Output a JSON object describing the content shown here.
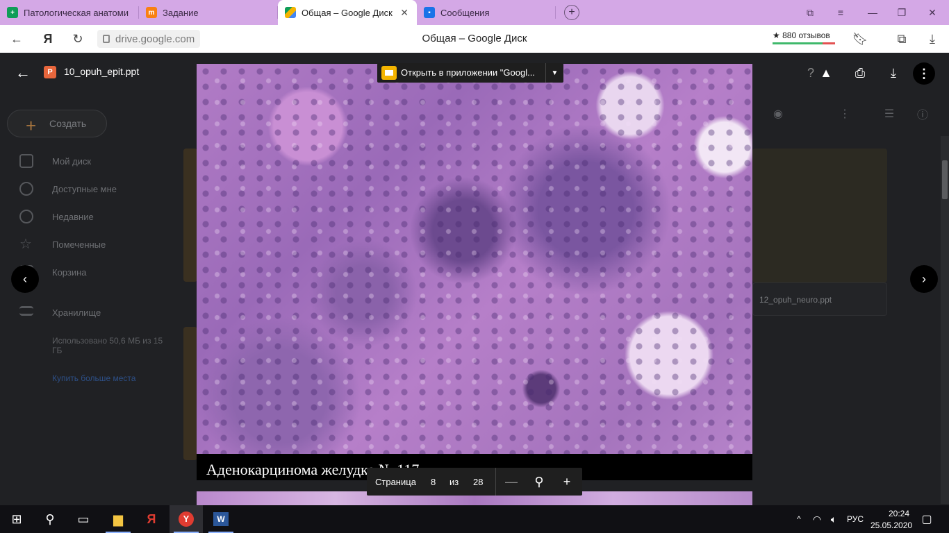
{
  "browser": {
    "tabs": [
      {
        "label": "Патологическая анатоми",
        "icon": "sheets-icon",
        "color": "#0f9d58"
      },
      {
        "label": "Задание",
        "icon": "moodle-icon",
        "color": "#f98012"
      },
      {
        "label": "Общая – Google Диск",
        "icon": "drive-icon",
        "color": "#4285f4",
        "active": true
      },
      {
        "label": "Сообщения",
        "icon": "chat-icon",
        "color": "#1a73e8"
      }
    ],
    "url": "drive.google.com",
    "page_title": "Общая – Google Диск",
    "reviews": "★ 880 отзывов"
  },
  "drive": {
    "create_label": "Создать",
    "sidebar": [
      {
        "label": "Мой диск",
        "icon": "my-drive-icon"
      },
      {
        "label": "Доступные мне",
        "icon": "shared-icon"
      },
      {
        "label": "Недавние",
        "icon": "clock-icon"
      },
      {
        "label": "Помеченные",
        "icon": "star-icon"
      },
      {
        "label": "Корзина",
        "icon": "trash-icon"
      }
    ],
    "storage_label": "Хранилище",
    "storage_used": "Использовано 50,6 МБ из 15 ГБ",
    "buy_storage": "Купить больше места",
    "file_right": "12_opuh_neuro.ppt"
  },
  "viewer": {
    "file_name": "10_opuh_epit.ppt",
    "open_in_app": "Открыть в приложении \"Googl...",
    "caption": "Аденокарцинома желудка № 117",
    "pager": {
      "page_label": "Страница",
      "current": "8",
      "of_label": "из",
      "total": "28"
    }
  },
  "taskbar": {
    "lang": "РУС",
    "time": "20:24",
    "date": "25.05.2020"
  }
}
